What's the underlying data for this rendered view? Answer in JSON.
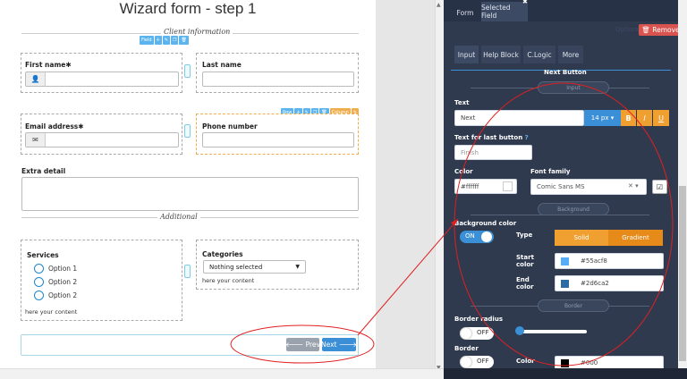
{
  "form": {
    "title": "Wizard form - step 1",
    "section_client": "Client information",
    "section_additional": "Additional",
    "field_toolbar": {
      "field": "Field",
      "plus": "✛",
      "edit": "✎",
      "copy": "❐",
      "del": "🗑"
    },
    "row_toolbar": {
      "row": "Row",
      "column": "Column"
    },
    "first_name_label": "First name",
    "last_name_label": "Last name",
    "email_label": "Email address",
    "phone_label": "Phone number",
    "extra_label": "Extra detail",
    "required_mark": "✱",
    "services_label": "Services",
    "services_options": [
      "Option 1",
      "Option 2",
      "Option 2"
    ],
    "services_help": "here your content",
    "categories_label": "Categories",
    "categories_selected": "Nothing selected",
    "categories_help": "here your content",
    "prev_label": "Prev",
    "next_label": "Next"
  },
  "panel": {
    "top_tabs": [
      "Form",
      "Selected Field"
    ],
    "options_label": "Options",
    "remove_label": "Remove",
    "sub_tabs": [
      "Input",
      "Help Block",
      "C.Logic",
      "More"
    ],
    "section_header": "Next Button",
    "pill_input": "Input",
    "text_label": "Text",
    "text_value": "Next",
    "font_size": "14 px",
    "bold": "B",
    "italic": "I",
    "underline": "U",
    "text_last_label": "Text for last button",
    "text_last_value": "Finish",
    "color_label": "Color",
    "color_value": "#ffffff",
    "font_family_label": "Font family",
    "font_family_value": "Comic Sans MS",
    "pill_background": "Background",
    "bg_color_label": "Background color",
    "bg_toggle": "ON",
    "type_label": "Type",
    "type_solid": "Solid",
    "type_gradient": "Gradient",
    "start_color_label": "Start color",
    "start_color_value": "#55acf8",
    "end_color_label": "End color",
    "end_color_value": "#2d6ca2",
    "pill_border": "Border",
    "border_radius_label": "Border radius",
    "border_radius_toggle": "OFF",
    "border_label": "Border",
    "border_toggle": "OFF",
    "border_color_label": "Color",
    "border_color_value": "#000",
    "colors": {
      "accent_blue": "#3a8fd6",
      "orange": "#f0a030",
      "red": "#d9534f",
      "panel_bg": "#2f3a4f"
    }
  }
}
